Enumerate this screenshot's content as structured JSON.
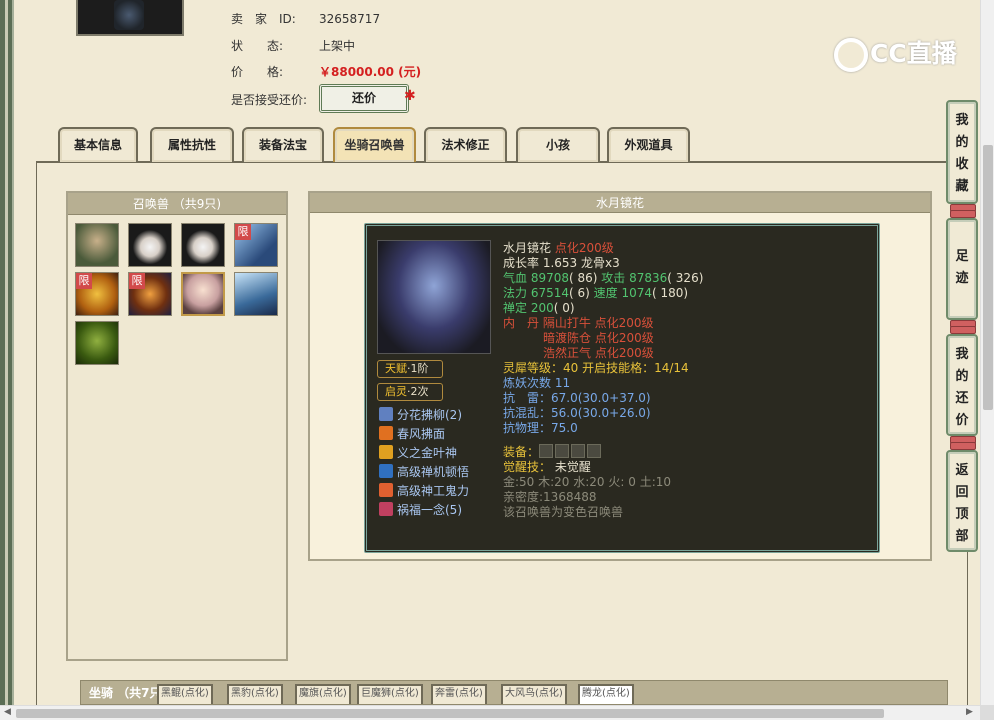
{
  "seller": {
    "id_label": "卖　家　ID:",
    "id_value": "32658717",
    "status_label": "状　　态:",
    "status_value": "上架中",
    "price_label": "价　　格:",
    "price_value": "￥88000.00 (元)",
    "bargain_label": "是否接受还价:",
    "bargain_button": "还价",
    "bargain_mark": "✱"
  },
  "tabs": [
    "基本信息",
    "属性抗性",
    "装备法宝",
    "坐骑召唤兽",
    "法术修正",
    "小孩",
    "外观道具"
  ],
  "active_tab": "坐骑召唤兽",
  "summon_panel": {
    "title": "召唤兽 （共9只)",
    "limit_badge": "限"
  },
  "detail": {
    "title": "水月镜花",
    "name": "水月镜花",
    "name_tag": " 点化200级",
    "growth": "成长率 1.653 龙骨x3",
    "hp_label": "气血 ",
    "hp": "89708",
    "hp_extra": "( 86)",
    "atk_label": " 攻击 ",
    "atk": "87836",
    "atk_extra": "( 326)",
    "mp_label": "法力 ",
    "mp": "67514",
    "mp_extra": "( 6)",
    "spd_label": " 速度 ",
    "spd": "1074",
    "spd_extra": "( 180)",
    "zen_label": "禅定 ",
    "zen": "200",
    "zen_extra": "( 0)",
    "dan_label": "内　丹 ",
    "dan1": "隔山打牛 点化200级",
    "dan2": "暗渡陈仓 点化200级",
    "dan3": "浩然正气 点化200级",
    "lingxi": "灵犀等级：40 开启技能格：14/14",
    "refine": "炼妖次数 11",
    "res_thunder_label": "抗　雷：",
    "res_thunder": "67.0(30.0+37.0)",
    "res_chaos_label": "抗混乱：",
    "res_chaos": "56.0(30.0+26.0)",
    "res_phys_label": "抗物理：",
    "res_phys": "75.0",
    "equip_label": "装备：",
    "awaken_label": "觉醒技：",
    "awaken_value": " 未觉醒",
    "elements": "金:50 木:20 水:20 火: 0 土:10",
    "intimacy": "亲密度:1368488",
    "note": "该召唤兽为变色召唤兽",
    "talent_label": "天赋",
    "talent_value": "·1阶",
    "spirit_label": "启灵",
    "spirit_value": "·2次",
    "skills": [
      "分花拂柳(2)",
      "春风拂面",
      "义之金叶神",
      "高级禅机顿悟",
      "高级神工鬼力",
      "祸福一念(5)"
    ]
  },
  "side_buttons": [
    "我的收藏",
    "足迹",
    "我的还价",
    "返回顶部"
  ],
  "mounts": {
    "label": "坐骑 （共7只",
    "items": [
      "黑鲲(点化)",
      "黑豹(点化)",
      "魔旗(点化)",
      "巨魔狮(点化)",
      "奔雷(点化)",
      "大风鸟(点化)",
      "腾龙(点化)"
    ]
  },
  "watermark": "CC直播",
  "colors": {
    "accent_red": "#d42020",
    "frame_green": "#5b6e55",
    "panel_tan": "#b7af92",
    "card_bg": "#2a2920"
  }
}
